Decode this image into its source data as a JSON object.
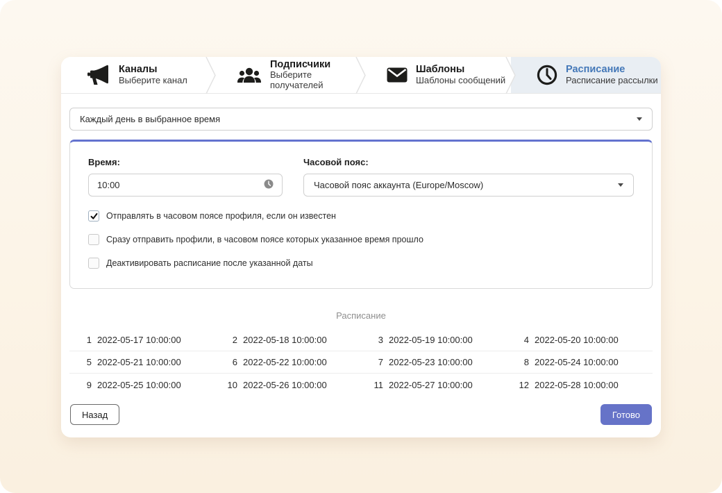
{
  "colors": {
    "accent_indigo": "#6673c8",
    "active_tab_blue": "#4478b8",
    "active_tab_bg": "#e9eef3",
    "page_cream": "#fcf4e7"
  },
  "tabs": [
    {
      "label": "Каналы",
      "sublabel": "Выберите канал",
      "icon": "megaphone-icon",
      "active": false
    },
    {
      "label": "Подписчики",
      "sublabel": "Выберите получателей",
      "icon": "subscribers-icon",
      "active": false
    },
    {
      "label": "Шаблоны",
      "sublabel": "Шаблоны сообщений",
      "icon": "envelope-icon",
      "active": false
    },
    {
      "label": "Расписание",
      "sublabel": "Расписание рассылки",
      "icon": "clock-icon",
      "active": true
    }
  ],
  "frequency_select": {
    "value": "Каждый день в выбранное время"
  },
  "panel": {
    "time_label": "Время:",
    "time_value": "10:00",
    "timezone_label": "Часовой пояс:",
    "timezone_value": "Часовой пояс аккаунта (Europe/Moscow)",
    "checkboxes": [
      {
        "label": "Отправлять в часовом поясе профиля, если он известен",
        "checked": true
      },
      {
        "label": "Сразу отправить профили, в часовом поясе которых указанное время прошло",
        "checked": false
      },
      {
        "label": "Деактивировать расписание после указанной даты",
        "checked": false
      }
    ]
  },
  "schedule": {
    "title": "Расписание",
    "items": [
      {
        "n": "1",
        "datetime": "2022-05-17 10:00:00"
      },
      {
        "n": "2",
        "datetime": "2022-05-18 10:00:00"
      },
      {
        "n": "3",
        "datetime": "2022-05-19 10:00:00"
      },
      {
        "n": "4",
        "datetime": "2022-05-20 10:00:00"
      },
      {
        "n": "5",
        "datetime": "2022-05-21 10:00:00"
      },
      {
        "n": "6",
        "datetime": "2022-05-22 10:00:00"
      },
      {
        "n": "7",
        "datetime": "2022-05-23 10:00:00"
      },
      {
        "n": "8",
        "datetime": "2022-05-24 10:00:00"
      },
      {
        "n": "9",
        "datetime": "2022-05-25 10:00:00"
      },
      {
        "n": "10",
        "datetime": "2022-05-26 10:00:00"
      },
      {
        "n": "11",
        "datetime": "2022-05-27 10:00:00"
      },
      {
        "n": "12",
        "datetime": "2022-05-28 10:00:00"
      }
    ]
  },
  "footer": {
    "back_label": "Назад",
    "done_label": "Готово"
  }
}
